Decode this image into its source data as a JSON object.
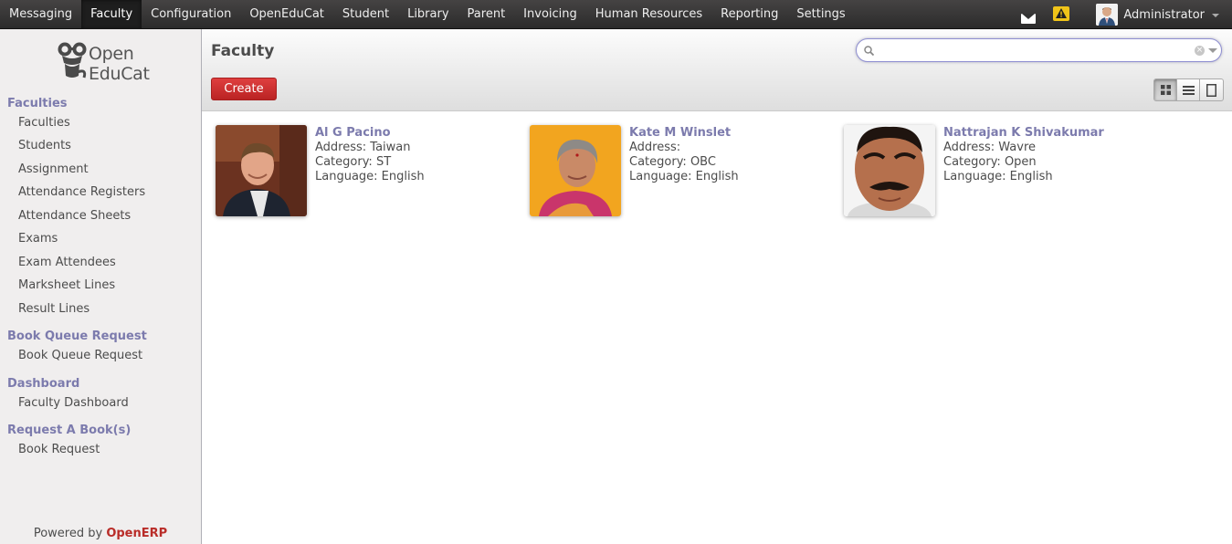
{
  "topmenu": [
    "Messaging",
    "Faculty",
    "Configuration",
    "OpenEduCat",
    "Student",
    "Library",
    "Parent",
    "Invoicing",
    "Human Resources",
    "Reporting",
    "Settings"
  ],
  "active_menu": "Faculty",
  "user": {
    "name": "Administrator"
  },
  "logo": {
    "line1": "Open",
    "line2": "EduCat"
  },
  "sidebar": {
    "sections": [
      {
        "title": "Faculties",
        "items": [
          "Faculties",
          "Students",
          "Assignment",
          "Attendance Registers",
          "Attendance Sheets",
          "Exams",
          "Exam Attendees",
          "Marksheet Lines",
          "Result Lines"
        ]
      },
      {
        "title": "Book Queue Request",
        "items": [
          "Book Queue Request"
        ]
      },
      {
        "title": "Dashboard",
        "items": [
          "Faculty Dashboard"
        ]
      },
      {
        "title": "Request A Book(s)",
        "items": [
          "Book Request"
        ]
      }
    ],
    "powered_prefix": "Powered by ",
    "powered_brand": "OpenERP"
  },
  "header": {
    "title": "Faculty",
    "create_label": "Create",
    "search_placeholder": ""
  },
  "views": [
    "kanban-view",
    "list-view",
    "form-view"
  ],
  "faculty": [
    {
      "name": "Al G Pacino",
      "address": "Address: Taiwan",
      "category": "Category: ST",
      "language": "Language: English"
    },
    {
      "name": "Kate M Winslet",
      "address": "Address:",
      "category": "Category: OBC",
      "language": "Language: English"
    },
    {
      "name": "Nattrajan K Shivakumar",
      "address": "Address: Wavre",
      "category": "Category: Open",
      "language": "Language: English"
    }
  ],
  "colors": {
    "accent": "#7c7bad",
    "create": "#c52b2b",
    "brand": "#b92c28"
  }
}
